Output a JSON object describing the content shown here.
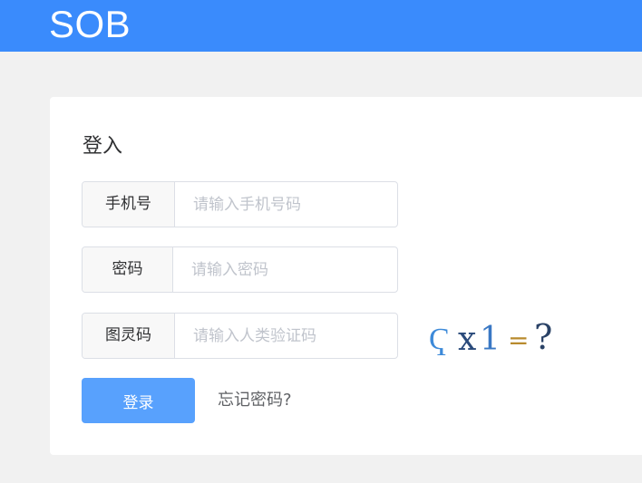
{
  "header": {
    "logo": "SOB",
    "bg_color": "#3a8bfc"
  },
  "login": {
    "title": "登入",
    "phone": {
      "label": "手机号",
      "placeholder": "请输入手机号码",
      "value": ""
    },
    "password": {
      "label": "密码",
      "placeholder": "请输入密码",
      "value": ""
    },
    "captcha": {
      "label": "图灵码",
      "placeholder": "请输入人类验证码",
      "value": "",
      "image_text": "ᑭ𝗑1 = ?",
      "glyphs": [
        "Ҁ",
        "x",
        "1",
        "=",
        "?"
      ]
    },
    "submit_label": "登录",
    "forgot_label": "忘记密码?",
    "button_color": "#58a1fd"
  }
}
